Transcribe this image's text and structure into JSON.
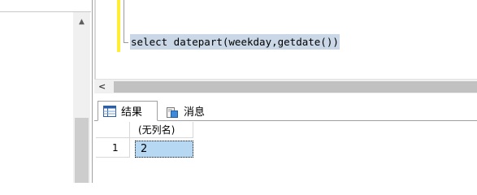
{
  "editor": {
    "sql_text": "select datepart(weekday,getdate())",
    "highlight_color": "#c9d7e6",
    "change_bar_color": "#ffee33"
  },
  "scrollbars": {
    "left_pane_up_arrow": "▲",
    "editor_left_arrow": "<"
  },
  "result_tabs": [
    {
      "label": "结果",
      "icon": "grid-icon",
      "selected": true
    },
    {
      "label": "消息",
      "icon": "messages-icon",
      "selected": false
    }
  ],
  "results_grid": {
    "columns": [
      "(无列名)"
    ],
    "rows": [
      {
        "row_number": "1",
        "cells": [
          "2"
        ]
      }
    ],
    "selected_cell_color": "#b6d8f2"
  }
}
